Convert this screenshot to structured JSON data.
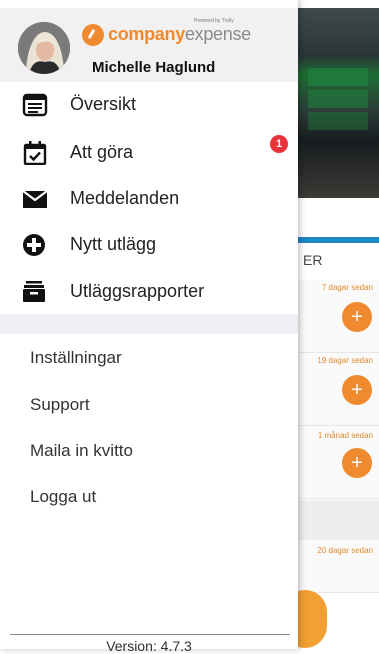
{
  "user": {
    "name": "Michelle Haglund"
  },
  "brand": {
    "part1": "company",
    "part2": "expense",
    "powered": "Powered by Trolly",
    "accent": "#f08a2e"
  },
  "menu": {
    "items": [
      {
        "label": "Översikt",
        "icon": "calendar-list-icon"
      },
      {
        "label": "Att göra",
        "icon": "calendar-check-icon"
      },
      {
        "label": "Meddelanden",
        "icon": "envelope-icon"
      },
      {
        "label": "Nytt utlägg",
        "icon": "plus-circle-icon"
      },
      {
        "label": "Utläggsrapporter",
        "icon": "archive-box-icon"
      }
    ],
    "todo_badge": "1"
  },
  "links": [
    {
      "label": "Inställningar"
    },
    {
      "label": "Support"
    },
    {
      "label": "Maila in kvitto"
    },
    {
      "label": "Logga ut"
    }
  ],
  "footer": {
    "version": "Version: 4.7.3"
  },
  "background": {
    "header_fragment": "ER",
    "times": [
      "7 dagar sedan",
      "19 dagar sedan",
      "1 månad sedan",
      "20 dagar sedan"
    ]
  }
}
